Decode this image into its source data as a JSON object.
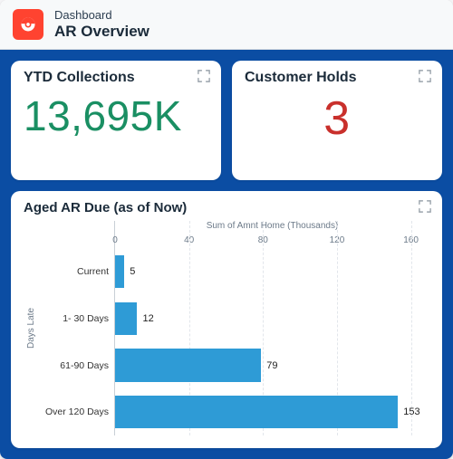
{
  "header": {
    "dashboard_label": "Dashboard",
    "title": "AR Overview",
    "icon": "pokeball-icon"
  },
  "kpis": [
    {
      "id": "ytd",
      "title": "YTD Collections",
      "value": "13,695K",
      "color": "green"
    },
    {
      "id": "holds",
      "title": "Customer Holds",
      "value": "3",
      "color": "red"
    }
  ],
  "chart_card": {
    "title": "Aged AR Due (as of Now)",
    "xlabel": "Sum of Amnt Home (Thousands)",
    "ylabel": "Days Late"
  },
  "chart_data": {
    "type": "bar",
    "orientation": "horizontal",
    "title": "Aged AR Due (as of Now)",
    "xlabel": "Sum of Amnt Home (Thousands)",
    "ylabel": "Days Late",
    "xlim": [
      0,
      170
    ],
    "ticks": [
      0,
      40,
      80,
      120,
      160
    ],
    "categories": [
      "Current",
      "1- 30 Days",
      "61-90 Days",
      "Over 120 Days"
    ],
    "values": [
      5,
      12,
      79,
      153
    ],
    "series_color": "#2e9bd6"
  }
}
